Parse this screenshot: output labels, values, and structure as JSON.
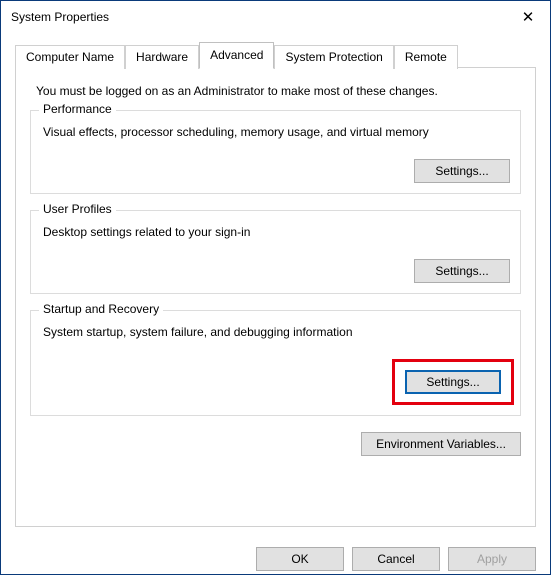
{
  "window": {
    "title": "System Properties",
    "close_icon": "✕"
  },
  "tabs": {
    "computer_name": "Computer Name",
    "hardware": "Hardware",
    "advanced": "Advanced",
    "system_protection": "System Protection",
    "remote": "Remote",
    "active": "advanced"
  },
  "advanced": {
    "intro": "You must be logged on as an Administrator to make most of these changes.",
    "performance": {
      "legend": "Performance",
      "desc": "Visual effects, processor scheduling, memory usage, and virtual memory",
      "settings_label": "Settings..."
    },
    "user_profiles": {
      "legend": "User Profiles",
      "desc": "Desktop settings related to your sign-in",
      "settings_label": "Settings..."
    },
    "startup_recovery": {
      "legend": "Startup and Recovery",
      "desc": "System startup, system failure, and debugging information",
      "settings_label": "Settings..."
    },
    "env_vars_label": "Environment Variables..."
  },
  "dialog_buttons": {
    "ok": "OK",
    "cancel": "Cancel",
    "apply": "Apply"
  }
}
